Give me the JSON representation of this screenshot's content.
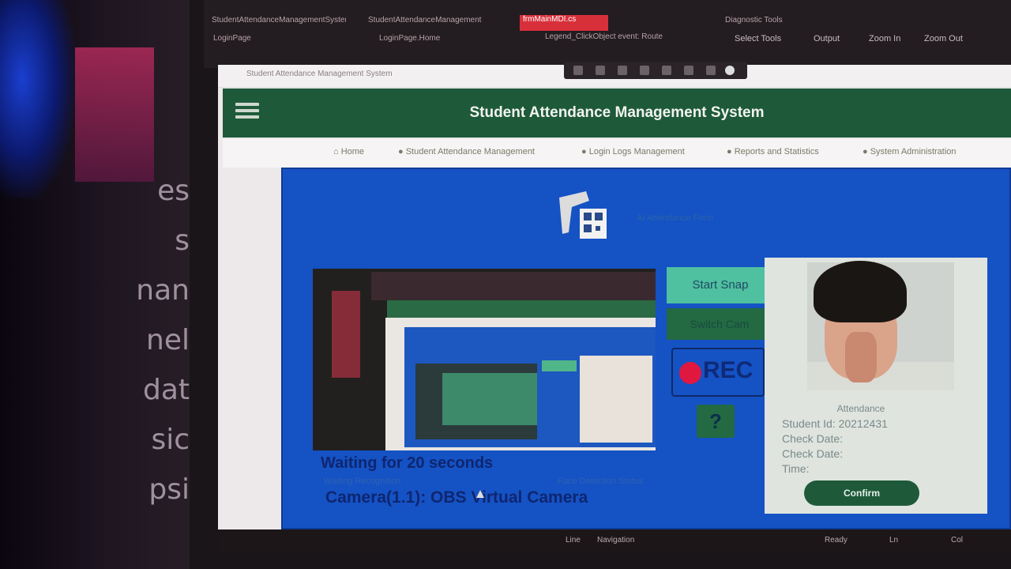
{
  "editor": {
    "file_tabs": [
      "StudentAttendanceManagementSystem.sln",
      "StudentAttendanceManagement",
      "frmMainMDI.cs",
      "Diagnostic Tools"
    ],
    "doc_tabs": [
      "LoginPage",
      "LoginPage.Home",
      "Legend_ClickObject event: Route"
    ],
    "toolbar": [
      "Select Tools",
      "Output",
      "Zoom In",
      "Zoom Out"
    ]
  },
  "window": {
    "title": "Student Attendance Management System"
  },
  "app": {
    "title": "Student Attendance Management System",
    "nav": [
      "Home",
      "Student Attendance Management",
      "Login Logs Management",
      "Reports and Statistics",
      "System Administration"
    ],
    "logo_text": "AI Attendance Form"
  },
  "camera": {
    "start_snap_label": "Start Snap",
    "switch_cam_label": "Switch Cam",
    "rec_label": "REC",
    "help_label": "?",
    "waiting_text": "Waiting for 20 seconds",
    "small_status": "Waiting Recognition",
    "small_status_right": "Face Detection Status",
    "camera_label": "Camera(1.1): OBS Virtual Camera"
  },
  "result": {
    "lines": [
      "Attendance",
      "Student Id: 20212431",
      "Check Date:",
      "Check Date:",
      "Time:"
    ],
    "confirm_label": "Confirm"
  },
  "status_bar": [
    "Line",
    "Navigation",
    "Ready",
    "Ln",
    "Col"
  ],
  "background_text": [
    "es",
    "s",
    "nan",
    "nel",
    "dat",
    "sic",
    "psi"
  ],
  "colors": {
    "header_green": "#1e5a3a",
    "panel_blue": "#1552c4",
    "start_snap": "#4fc0a0",
    "rec_red": "#e01840"
  }
}
